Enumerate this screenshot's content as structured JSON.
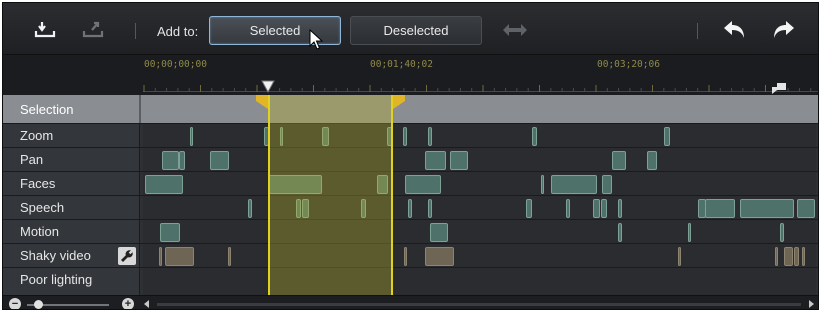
{
  "toolbar": {
    "add_to_label": "Add to:",
    "selected_label": "Selected",
    "deselected_label": "Deselected",
    "icons": [
      "import-icon",
      "export-icon",
      "swap-arrows-icon",
      "undo-icon",
      "redo-icon"
    ]
  },
  "ruler": {
    "timecodes": [
      "00;00;00;00",
      "00;01;40;02",
      "00;03;20;06"
    ]
  },
  "selection_row": {
    "label": "Selection"
  },
  "tracks": [
    {
      "label": "Zoom"
    },
    {
      "label": "Pan"
    },
    {
      "label": "Faces"
    },
    {
      "label": "Speech"
    },
    {
      "label": "Motion"
    },
    {
      "label": "Shaky video"
    },
    {
      "label": "Poor lighting"
    }
  ],
  "colors": {
    "accent_selection": "#e2d21c",
    "clip_green": "#4e7169",
    "clip_brown": "#6e6555",
    "timecode": "#8f8a4a"
  }
}
